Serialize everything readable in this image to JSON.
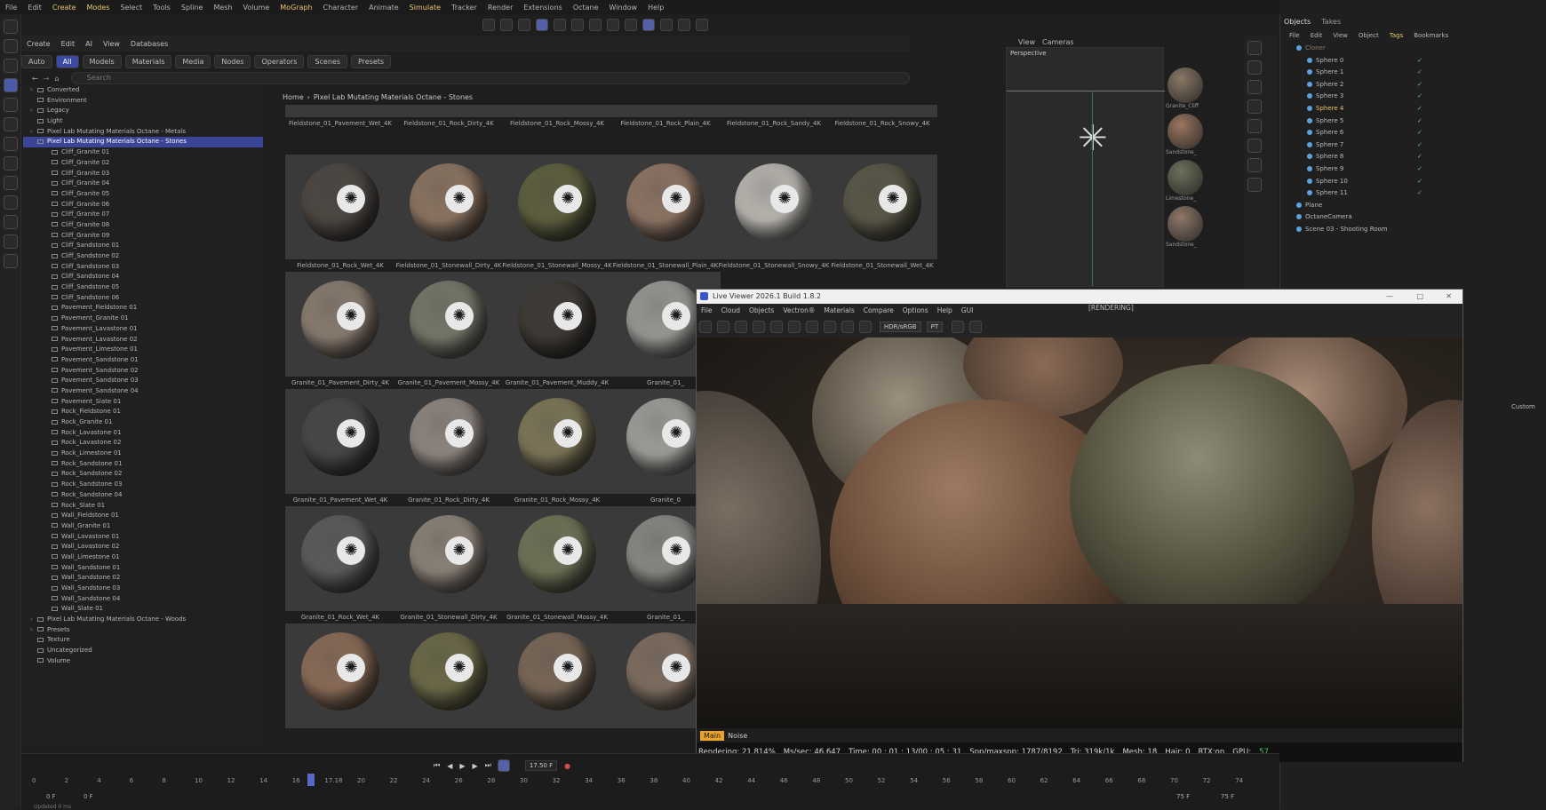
{
  "menu": [
    "File",
    "Edit",
    "Create",
    "Modes",
    "Select",
    "Tools",
    "Spline",
    "Mesh",
    "Volume",
    "MoGraph",
    "Character",
    "Animate",
    "Simulate",
    "Tracker",
    "Render",
    "Extensions",
    "Octane",
    "Window",
    "Help"
  ],
  "menu_highlight": [
    "Create",
    "Modes",
    "MoGraph",
    "Simulate"
  ],
  "asset_menu": [
    "Create",
    "Edit",
    "AI",
    "View",
    "Databases"
  ],
  "tags": [
    "Auto",
    "All",
    "Models",
    "Materials",
    "Media",
    "Nodes",
    "Operators",
    "Scenes",
    "Presets"
  ],
  "active_tag": "All",
  "search_placeholder": "Search",
  "breadcrumb": [
    "Home",
    "Pixel Lab Mutating Materials Octane - Stones"
  ],
  "tree": [
    {
      "label": "Converted",
      "indent": 1,
      "arrow": true
    },
    {
      "label": "Environment",
      "indent": 1
    },
    {
      "label": "Legacy",
      "indent": 1,
      "arrow": true
    },
    {
      "label": "Light",
      "indent": 1
    },
    {
      "label": "Pixel Lab Mutating Materials Octane - Metals",
      "indent": 1,
      "arrow": true
    },
    {
      "label": "Pixel Lab Mutating Materials Octane - Stones",
      "indent": 1,
      "selected": true
    },
    {
      "label": "Cliff_Granite 01",
      "indent": 2
    },
    {
      "label": "Cliff_Granite 02",
      "indent": 2
    },
    {
      "label": "Cliff_Granite 03",
      "indent": 2
    },
    {
      "label": "Cliff_Granite 04",
      "indent": 2
    },
    {
      "label": "Cliff_Granite 05",
      "indent": 2
    },
    {
      "label": "Cliff_Granite 06",
      "indent": 2
    },
    {
      "label": "Cliff_Granite 07",
      "indent": 2
    },
    {
      "label": "Cliff_Granite 08",
      "indent": 2
    },
    {
      "label": "Cliff_Granite 09",
      "indent": 2
    },
    {
      "label": "Cliff_Sandstone 01",
      "indent": 2
    },
    {
      "label": "Cliff_Sandstone 02",
      "indent": 2
    },
    {
      "label": "Cliff_Sandstone 03",
      "indent": 2
    },
    {
      "label": "Cliff_Sandstone 04",
      "indent": 2
    },
    {
      "label": "Cliff_Sandstone 05",
      "indent": 2
    },
    {
      "label": "Cliff_Sandstone 06",
      "indent": 2
    },
    {
      "label": "Pavement_Fieldstone 01",
      "indent": 2
    },
    {
      "label": "Pavement_Granite 01",
      "indent": 2
    },
    {
      "label": "Pavement_Lavastone 01",
      "indent": 2
    },
    {
      "label": "Pavement_Lavastone 02",
      "indent": 2
    },
    {
      "label": "Pavement_Limestone 01",
      "indent": 2
    },
    {
      "label": "Pavement_Sandstone 01",
      "indent": 2
    },
    {
      "label": "Pavement_Sandstone 02",
      "indent": 2
    },
    {
      "label": "Pavement_Sandstone 03",
      "indent": 2
    },
    {
      "label": "Pavement_Sandstone 04",
      "indent": 2
    },
    {
      "label": "Pavement_Slate 01",
      "indent": 2
    },
    {
      "label": "Rock_Fieldstone 01",
      "indent": 2
    },
    {
      "label": "Rock_Granite 01",
      "indent": 2
    },
    {
      "label": "Rock_Lavastone 01",
      "indent": 2
    },
    {
      "label": "Rock_Lavastone 02",
      "indent": 2
    },
    {
      "label": "Rock_Limestone 01",
      "indent": 2
    },
    {
      "label": "Rock_Sandstone 01",
      "indent": 2
    },
    {
      "label": "Rock_Sandstone 02",
      "indent": 2
    },
    {
      "label": "Rock_Sandstone 03",
      "indent": 2
    },
    {
      "label": "Rock_Sandstone 04",
      "indent": 2
    },
    {
      "label": "Rock_Slate 01",
      "indent": 2
    },
    {
      "label": "Wall_Fieldstone 01",
      "indent": 2
    },
    {
      "label": "Wall_Granite 01",
      "indent": 2
    },
    {
      "label": "Wall_Lavastone 01",
      "indent": 2
    },
    {
      "label": "Wall_Lavastone 02",
      "indent": 2
    },
    {
      "label": "Wall_Limestone 01",
      "indent": 2
    },
    {
      "label": "Wall_Sandstone 01",
      "indent": 2
    },
    {
      "label": "Wall_Sandstone 02",
      "indent": 2
    },
    {
      "label": "Wall_Sandstone 03",
      "indent": 2
    },
    {
      "label": "Wall_Sandstone 04",
      "indent": 2
    },
    {
      "label": "Wall_Slate 01",
      "indent": 2
    },
    {
      "label": "Pixel Lab Mutating Materials Octane - Woods",
      "indent": 1,
      "arrow": true
    },
    {
      "label": "Presets",
      "indent": 1,
      "arrow": true
    },
    {
      "label": "Texture",
      "indent": 1
    },
    {
      "label": "Uncategorized",
      "indent": 1
    },
    {
      "label": "Volume",
      "indent": 1
    }
  ],
  "assets": [
    {
      "name": "Fieldstone_01_Pavement_Wet_4K",
      "color": "#6a5a4c"
    },
    {
      "name": "Fieldstone_01_Rock_Dirty_4K",
      "color": "#7d6c5a"
    },
    {
      "name": "Fieldstone_01_Rock_Mossy_4K",
      "color": "#6b6448"
    },
    {
      "name": "Fieldstone_01_Rock_Plain_4K",
      "color": "#8a7462"
    },
    {
      "name": "Fieldstone_01_Rock_Sandy_4K",
      "color": "#8b7a64"
    },
    {
      "name": "Fieldstone_01_Rock_Snowy_4K",
      "color": "#b3b0aa"
    },
    {
      "name": "Fieldstone_01_Rock_Wet_4K",
      "color": "#4e4843"
    },
    {
      "name": "Fieldstone_01_Stonewall_Dirty_4K",
      "color": "#8c7563"
    },
    {
      "name": "Fieldstone_01_Stonewall_Mossy_4K",
      "color": "#5e6040"
    },
    {
      "name": "Fieldstone_01_Stonewall_Plain_4K",
      "color": "#8e7565"
    },
    {
      "name": "Fieldstone_01_Stonewall_Snowy_4K",
      "color": "#b9b6b0"
    },
    {
      "name": "Fieldstone_01_Stonewall_Wet_4K",
      "color": "#5a5848"
    },
    {
      "name": "Granite_01_Pavement_Dirty_4K",
      "color": "#8a7c70"
    },
    {
      "name": "Granite_01_Pavement_Mossy_4K",
      "color": "#76786a"
    },
    {
      "name": "Granite_01_Pavement_Muddy_4K",
      "color": "#3e3a35"
    },
    {
      "name": "Granite_01_",
      "color": "#9a9894"
    },
    {
      "name": "Granite_01_Pavement_Wet_4K",
      "color": "#4a4846"
    },
    {
      "name": "Granite_01_Rock_Dirty_4K",
      "color": "#8f8680"
    },
    {
      "name": "Granite_01_Rock_Mossy_4K",
      "color": "#7d7658"
    },
    {
      "name": "Granite_0",
      "color": "#a09e9a"
    },
    {
      "name": "Granite_01_Rock_Wet_4K",
      "color": "#5e5c5a"
    },
    {
      "name": "Granite_01_Stonewall_Dirty_4K",
      "color": "#8c8278"
    },
    {
      "name": "Granite_01_Stonewall_Mossy_4K",
      "color": "#6e7458"
    },
    {
      "name": "Granite_01_",
      "color": "#8a8884"
    },
    {
      "name": "",
      "color": "#8a6c58"
    },
    {
      "name": "",
      "color": "#6c6a48"
    },
    {
      "name": "",
      "color": "#7a6858"
    },
    {
      "name": "",
      "color": "#7e6e60"
    }
  ],
  "viewport": {
    "label": "Perspective",
    "menu": [
      "View",
      "Cameras"
    ]
  },
  "side_mats": [
    "Granite_Cliff",
    "Sandstone_",
    "Limestone_",
    "Sandstone_"
  ],
  "objects_tabs": [
    "Objects",
    "Takes"
  ],
  "objects_menu": [
    "File",
    "Edit",
    "View",
    "Object",
    "Tags",
    "Bookmarks"
  ],
  "objects": [
    {
      "label": "Cloner",
      "cls": "dim"
    },
    {
      "label": "Sphere 0"
    },
    {
      "label": "Sphere 1"
    },
    {
      "label": "Sphere 2"
    },
    {
      "label": "Sphere 3"
    },
    {
      "label": "Sphere 4",
      "cls": "hl"
    },
    {
      "label": "Sphere 5"
    },
    {
      "label": "Sphere 6"
    },
    {
      "label": "Sphere 7"
    },
    {
      "label": "Sphere 8"
    },
    {
      "label": "Sphere 9"
    },
    {
      "label": "Sphere 10"
    },
    {
      "label": "Sphere 11"
    },
    {
      "label": "Plane"
    },
    {
      "label": "OctaneCamera"
    },
    {
      "label": "Scene 03 - Shooting Room"
    }
  ],
  "layer_custom": "Custom",
  "live_viewer": {
    "title": "Live Viewer 2026.1 Build 1.8.2",
    "menu": [
      "File",
      "Cloud",
      "Objects",
      "Vectron®",
      "Materials",
      "Compare",
      "Options",
      "Help",
      "GUI"
    ],
    "state": "[RENDERING]",
    "colorspace": "HDR/sRGB",
    "mode": "PT",
    "tabs": [
      "Main",
      "Noise"
    ],
    "status": {
      "rendering": "Rendering: 21.814%",
      "ms": "Ms/sec: 46.647",
      "time": "Time: 00 : 01 : 13/00 : 05 : 31",
      "spp": "Spp/maxspp: 1787/8192",
      "tri": "Tri: 319k/1k",
      "mesh": "Mesh: 18",
      "hair": "Hair: 0",
      "rtx": "RTX:on",
      "gpu": "GPU:",
      "gpu_val": "57"
    }
  },
  "timeline": {
    "ticks": [
      "0",
      "2",
      "4",
      "6",
      "8",
      "10",
      "12",
      "14",
      "16",
      "17.18",
      "20",
      "22",
      "24",
      "26",
      "28",
      "30",
      "32",
      "34",
      "36",
      "38",
      "40",
      "42",
      "44",
      "46",
      "48",
      "50",
      "52",
      "54",
      "56",
      "58",
      "60",
      "62",
      "64",
      "66",
      "68",
      "70",
      "72",
      "74"
    ],
    "frame": "17.50 F",
    "start": "0 F",
    "start2": "0 F",
    "end": "75 F",
    "end2": "75 F",
    "status_left": "Updated 0 ms"
  },
  "colors": {
    "accent": "#3d4aa3",
    "highlight": "#e9c66b",
    "render_green": "#3fc26d"
  }
}
